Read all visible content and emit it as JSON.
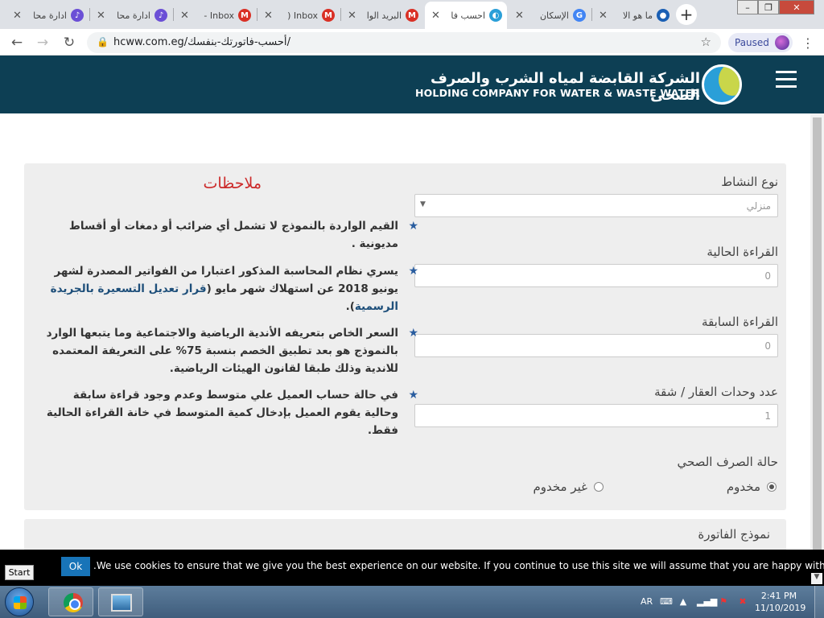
{
  "browser": {
    "tabs": [
      {
        "title": "ادارة محا",
        "color": "#6b4fd6",
        "glyph": "♪"
      },
      {
        "title": "ادارة محا",
        "color": "#6b4fd6",
        "glyph": "♪"
      },
      {
        "title": "Inbox -",
        "color": "#d93025",
        "glyph": "M"
      },
      {
        "title": "Inbox (",
        "color": "#d93025",
        "glyph": "M"
      },
      {
        "title": "البريد الوا",
        "color": "#d93025",
        "glyph": "M"
      },
      {
        "title": "احسب فا",
        "color": "#2a9fd8",
        "glyph": "◐"
      },
      {
        "title": "الإسكان",
        "color": "#4285f4",
        "glyph": "G"
      },
      {
        "title": "ما هو الا",
        "color": "#1a5fb4",
        "glyph": "●"
      }
    ],
    "active_tab_index": 5,
    "new_tab": "+",
    "url": "hcww.com.eg/أحسب-فاتورتك-بنفسك/",
    "paused_label": "Paused"
  },
  "site": {
    "logo_ar": "الشركة القابضة لمياه الشرب والصرف الصحى",
    "logo_en": "HOLDING COMPANY FOR WATER & WASTE WATER"
  },
  "form": {
    "activity_type": {
      "label": "نوع النشاط",
      "value": "منزلي"
    },
    "current_reading": {
      "label": "القراءة الحالية",
      "value": "0"
    },
    "previous_reading": {
      "label": "القراءة السابقة",
      "value": "0"
    },
    "units": {
      "label": "عدد وحدات العقار / شقة",
      "value": "1"
    },
    "sewage_status": {
      "label": "حالة الصرف الصحي",
      "options": [
        {
          "label": "مخدوم",
          "checked": true
        },
        {
          "label": "غير مخدوم",
          "checked": false
        }
      ]
    },
    "invoice_model_label": "نموذج الفاتورة"
  },
  "notes": {
    "title": "ملاحظات",
    "items": [
      {
        "text": "القيم الواردة بالنموذج لا تشمل أي ضرائب أو دمغات أو أقساط مديونية ."
      },
      {
        "text": "يسري نظام المحاسبة المذكور اعتبارا من الفواتير المصدرة لشهر يونيو 2018 عن استهلاك شهر مايو (",
        "link": "قرار تعديل التسعيرة بالجريدة الرسمية",
        "suffix": ")."
      },
      {
        "text": "السعر الخاص بتعريفه الأندية الرياضية والاجتماعية وما يتبعها الوارد بالنموذج هو بعد تطبيق الخصم بنسبة 75% على التعريفة المعتمده للاندية وذلك طبقا لقانون الهيئات الرياضية."
      },
      {
        "text": "في حالة حساب العميل علي متوسط وعدم وجود قراءة سابقة وحالية يقوم العميل بإدخال كمية المتوسط في خانة القراءة الحالية فقط."
      }
    ]
  },
  "cookie": {
    "message": ".We use cookies to ensure that we give you the best experience on our website. If you continue to use this site we will assume that you are happy with it",
    "ok_label": "Ok",
    "start_label": "Start"
  },
  "taskbar": {
    "language": "AR",
    "time": "2:41 PM",
    "date": "11/10/2019"
  }
}
